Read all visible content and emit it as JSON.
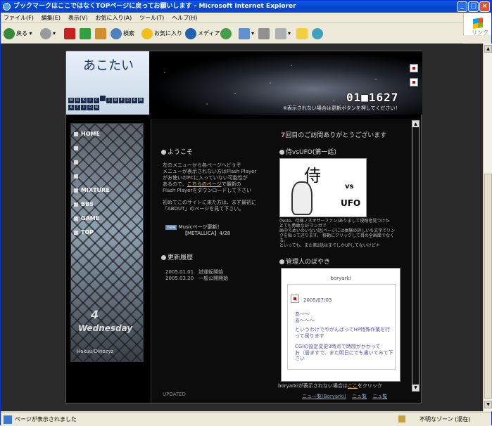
{
  "window": {
    "title": "ブックマークはここではなくTOPページに戻ってお願いします - Microsoft Internet Explorer"
  },
  "menu": [
    "ファイル(F)",
    "編集(E)",
    "表示(V)",
    "お気に入り(A)",
    "ツール(T)",
    "ヘルプ(H)"
  ],
  "toolbar": {
    "back": "戻る",
    "search": "検索",
    "favorites": "お気に入り",
    "media": "メディア",
    "link": "リンク"
  },
  "site": {
    "logo_text": "あこたい",
    "logo_grid": [
      "M",
      "U",
      "S",
      "I",
      "C",
      "",
      "I",
      "N",
      "F",
      "O",
      "R",
      "M",
      "A",
      "T",
      "I",
      "O",
      "N"
    ],
    "counter": "01■1627",
    "header_note": "※表示されない場合は更新ボタンを押してください！",
    "nav": [
      "HOME",
      "",
      "",
      "",
      "MIXTURE",
      "BBS",
      "GAME",
      "TOP"
    ],
    "date_num": "4",
    "date_day": "Wednesday",
    "credit": "Hakuu/Dinozyz",
    "visit": {
      "count": "7",
      "text": "回目のご訪問ありがとうございます"
    },
    "welcome": {
      "heading": "ようこそ",
      "para1": [
        "左のメニューから各ページへどうぞ",
        "メニューが表示されない方はFlash Player",
        "がお使いのPCに入っていない可能性が",
        "あるので、",
        "こちらのページ",
        "で最新の",
        "Flash Playerをダウンロードして下さい"
      ],
      "para2": [
        "初めてこのサイトに来た方は、まず最初に",
        "「ABOUT」のページを見て下さい。"
      ],
      "news_badge": "new",
      "news1": "Musicページ更新！",
      "news2": "【METALLICA】4/28"
    },
    "history": {
      "heading": "更新履歴",
      "rows": [
        "2005.01.01　試運転開始",
        "2005.03.20　一般公開開始"
      ]
    },
    "comic": {
      "heading": "侍vsUFO(第一話)",
      "title_k": "侍",
      "title_vs": "vs",
      "title_ufo": "UFO",
      "desc": [
        "(Note、侍様ノネオサーファン)ありまして侵略者見つけた",
        "とても勇敢なSFマンガで",
        "画中でめいのいない話(ページには体験の詳しいち文字でリン",
        "クを貼って辺ります。 移動にクリックして目の全画面でなく",
        "る。",
        "といっても、また第2話はまでしかUPしてないけど＊"
      ]
    },
    "blog": {
      "heading": "管理人のぼやき",
      "box_title": "boryarki",
      "date": "2005/07/03",
      "lines": [
        "あ〜〜",
        "あ〜〜〜",
        "というわけでやがんばってHP特殊作業を行",
        "って居ります",
        "CGIの設定変更3時点で時間がかかって",
        "お（居ますで、また明日にでも書いてみて下さい"
      ]
    },
    "bottom_note": {
      "pre": "boryarkiが表示されない場合は",
      "link": "ここ",
      "post": "をクリック"
    },
    "bottom_links": [
      "ニュ一覧(Boryarki)",
      "ニュ覧",
      "ニュ覧"
    ],
    "top_link": "UPDATED"
  },
  "status": {
    "text": "ページが表示されました",
    "zone": "不明なゾーン (混在)"
  }
}
